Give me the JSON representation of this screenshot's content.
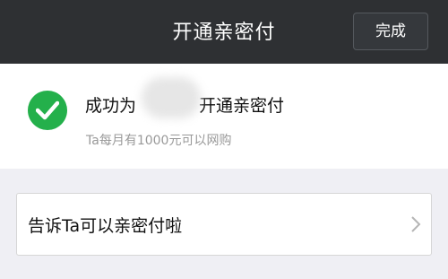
{
  "header": {
    "title": "开通亲密付",
    "done_label": "完成"
  },
  "result": {
    "title_prefix": "成功为",
    "title_suffix": "开通亲密付",
    "subtitle": "Ta每月有1000元可以网购",
    "icon": "check-circle-icon",
    "icon_color": "#24b04b"
  },
  "tell": {
    "label": "告诉Ta可以亲密付啦",
    "icon": "chevron-right-icon"
  },
  "colors": {
    "header_bg": "#2e3033",
    "page_bg": "#efeff4"
  }
}
